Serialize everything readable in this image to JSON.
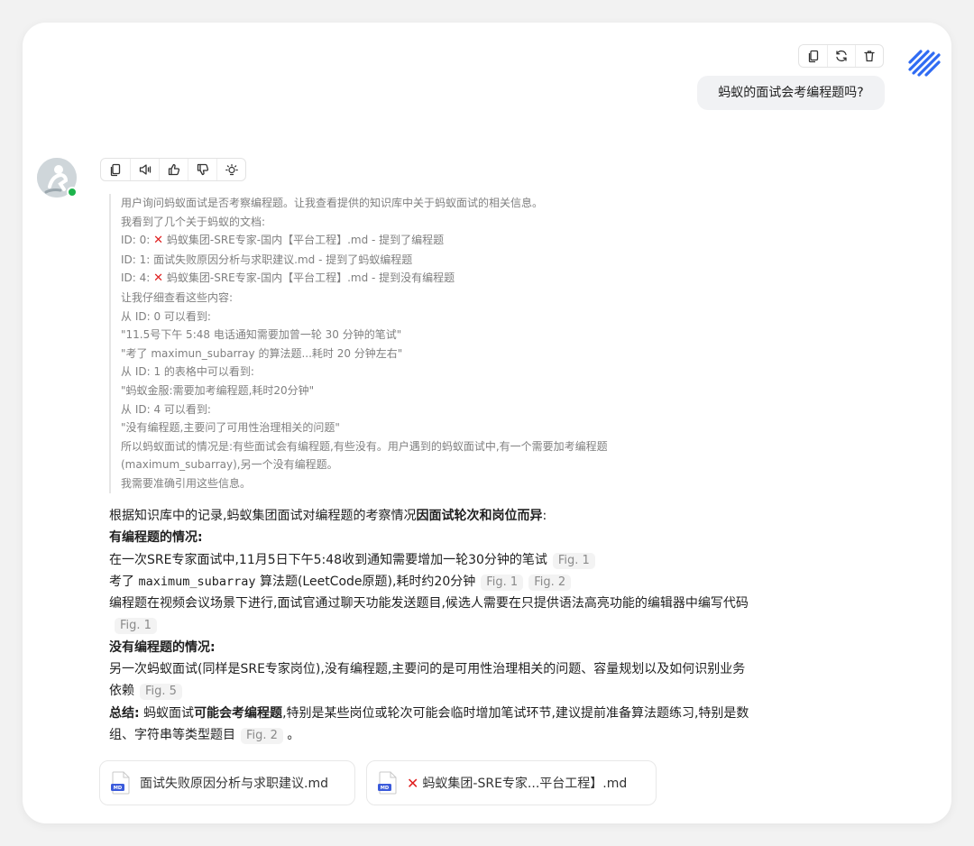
{
  "user": {
    "message": "蚂蚁的面试会考编程题吗?",
    "actions": [
      "copy-icon",
      "refresh-icon",
      "trash-icon"
    ]
  },
  "assistant": {
    "actions": [
      "copy-icon",
      "speaker-icon",
      "thumbs-up-icon",
      "thumbs-down-icon",
      "lightbulb-icon"
    ],
    "thinking": {
      "l0": "用户询问蚂蚁面试是否考察编程题。让我查看提供的知识库中关于蚂蚁面试的相关信息。",
      "l1": "我看到了几个关于蚂蚁的文档:",
      "l2_prefix": "ID: 0:",
      "l2_rest": "蚂蚁集团-SRE专家-国内【平台工程】.md - 提到了编程题",
      "l3": "ID: 1: 面试失败原因分析与求职建议.md - 提到了蚂蚁编程题",
      "l4_prefix": "ID: 4:",
      "l4_rest": "蚂蚁集团-SRE专家-国内【平台工程】.md - 提到没有编程题",
      "l5": "让我仔细查看这些内容:",
      "l6": "从 ID: 0 可以看到:",
      "l7": "\"11.5号下午 5:48 电话通知需要加曾一轮 30 分钟的笔试\"",
      "l8": "\"考了 maximun_subarray 的算法题...耗时 20 分钟左右\"",
      "l9": "从 ID: 1 的表格中可以看到:",
      "l10": "\"蚂蚁金服:需要加考编程题,耗时20分钟\"",
      "l11": "从 ID: 4 可以看到:",
      "l12": "\"没有编程题,主要问了可用性治理相关的问题\"",
      "l13": "所以蚂蚁面试的情况是:有些面试会有编程题,有些没有。用户遇到的蚂蚁面试中,有一个需要加考编程题(maximum_subarray),另一个没有编程题。",
      "l14": "我需要准确引用这些信息。"
    },
    "answer": {
      "intro": "根据知识库中的记录,蚂蚁集团面试对编程题的考察情况",
      "intro_bold": "因面试轮次和岗位而异",
      "intro_end": ":",
      "h1": "有编程题的情况:",
      "p1": "在一次SRE专家面试中,11月5日下午5:48收到通知需要增加一轮30分钟的笔试",
      "p1_fig": "Fig. 1",
      "p2_a": "考了",
      "p2_code": "maximum_subarray",
      "p2_b": "算法题(LeetCode原题),耗时约20分钟",
      "p2_fig1": "Fig. 1",
      "p2_fig2": "Fig. 2",
      "p3": "编程题在视频会议场景下进行,面试官通过聊天功能发送题目,候选人需要在只提供语法高亮功能的编辑器中编写代码",
      "p3_fig": "Fig. 1",
      "h2": "没有编程题的情况:",
      "p4": "另一次蚂蚁面试(同样是SRE专家岗位),没有编程题,主要问的是可用性治理相关的问题、容量规划以及如何识别业务依赖",
      "p4_fig": "Fig. 5",
      "s_label": "总结:",
      "s_a": "蚂蚁面试",
      "s_bold": "可能会考编程题",
      "s_b": ",特别是某些岗位或轮次可能会临时增加笔试环节,建议提前准备算法题练习,特别是数组、字符串等类型题目",
      "s_fig": "Fig. 2",
      "s_end": "。"
    },
    "files": {
      "f1": "面试失败原因分析与求职建议.md",
      "f2": "蚂蚁集团-SRE专家...平台工程】.md",
      "icon_label": "MD"
    }
  },
  "colors": {
    "accent": "#2f6bf3",
    "online": "#1db34b",
    "error": "#e02020"
  }
}
